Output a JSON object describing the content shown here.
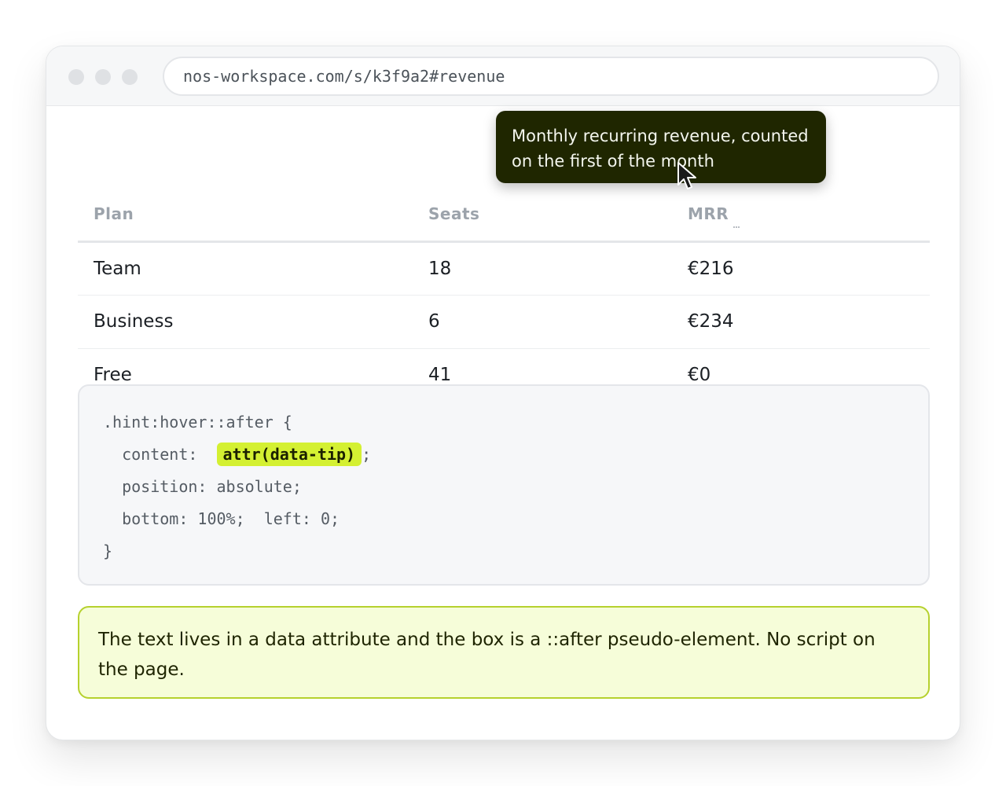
{
  "browser": {
    "url": "nos-workspace.com/s/k3f9a2#revenue"
  },
  "tooltip": {
    "text": "Monthly recurring revenue, counted on the first of the month"
  },
  "table": {
    "headers": [
      "Plan",
      "Seats",
      "MRR"
    ],
    "rows": [
      [
        "Team",
        "18",
        "€216"
      ],
      [
        "Business",
        "6",
        "€234"
      ],
      [
        "Free",
        "41",
        "€0"
      ]
    ]
  },
  "code": {
    "line1": ".hint:hover::after {",
    "line2_prefix": "  content:  ",
    "line2_highlight": "attr(data-tip)",
    "line2_suffix": ";",
    "line3": "  position: absolute;",
    "line4": "  bottom: 100%;  left: 0;",
    "line5": "}"
  },
  "note": {
    "text": "The text lives in a data attribute and the box is a ::after pseudo-element. No script on the page."
  },
  "icons": {
    "cursor": "arrow-cursor-icon"
  }
}
